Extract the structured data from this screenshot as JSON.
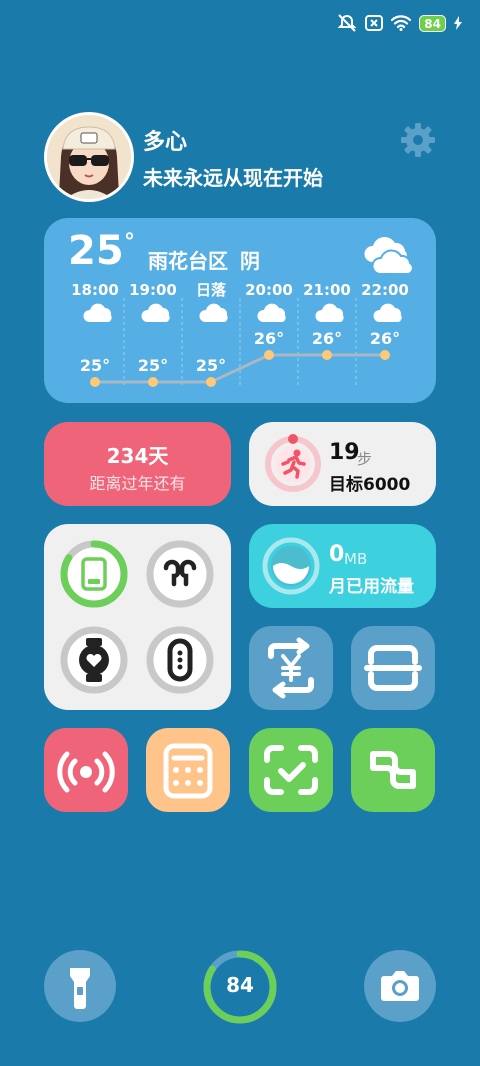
{
  "status_bar": {
    "battery": "84",
    "icons": [
      "mute-icon",
      "sim-off-icon",
      "wifi-icon",
      "battery-icon",
      "charging-icon"
    ]
  },
  "profile": {
    "name": "多心",
    "motto": "未来永远从现在开始"
  },
  "weather": {
    "temp": "25",
    "degree": "°",
    "location": "雨花台区",
    "condition": "阴",
    "hours": [
      {
        "time": "18:00",
        "temp": "25°"
      },
      {
        "time": "19:00",
        "temp": "25°"
      },
      {
        "time": "日落",
        "temp": "25°"
      },
      {
        "time": "20:00",
        "temp": "26°"
      },
      {
        "time": "21:00",
        "temp": "26°"
      },
      {
        "time": "22:00",
        "temp": "26°"
      }
    ],
    "chart_values": [
      25,
      25,
      25,
      26,
      26,
      26
    ]
  },
  "countdown": {
    "days": "234天",
    "label": "距离过年还有"
  },
  "steps": {
    "count": "19",
    "unit": "步",
    "goal": "目标6000"
  },
  "data_usage": {
    "value": "0",
    "unit": "MB",
    "label": "月已用流量"
  },
  "bottom": {
    "battery_level": "84",
    "battery_fraction": 0.84
  },
  "colors": {
    "background": "#1a7bab",
    "weather": "#55aee4",
    "pink": "#ef6479",
    "cyan": "#3dd0de",
    "green": "#6bcf5a",
    "orange": "#ffc48a"
  }
}
